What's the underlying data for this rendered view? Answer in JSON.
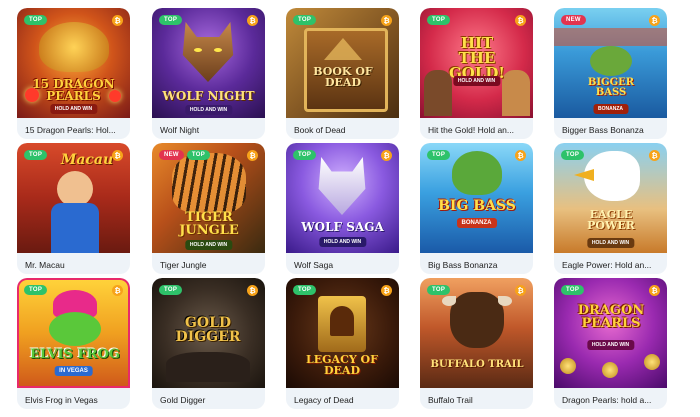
{
  "games": [
    {
      "title": "15 Dragon Pearls: Hol...",
      "badges": [
        "TOP"
      ],
      "bitcoin": true,
      "logo": "15 DRAGON PEARLS",
      "subtitle": "HOLD AND WIN"
    },
    {
      "title": "Wolf Night",
      "badges": [
        "TOP"
      ],
      "bitcoin": true,
      "logo": "WOLF NIGHT",
      "subtitle": "HOLD AND WIN"
    },
    {
      "title": "Book of Dead",
      "badges": [
        "TOP"
      ],
      "bitcoin": true,
      "logo": "BOOK OF DEAD",
      "subtitle": ""
    },
    {
      "title": "Hit the Gold! Hold an...",
      "badges": [
        "TOP"
      ],
      "bitcoin": true,
      "logo": "HIT THE GOLD!",
      "subtitle": "HOLD AND WIN"
    },
    {
      "title": "Bigger Bass Bonanza",
      "badges": [
        "NEW"
      ],
      "bitcoin": true,
      "logo": "BIGGER BASS",
      "subtitle": "BONANZA"
    },
    {
      "title": "Mr. Macau",
      "badges": [
        "TOP"
      ],
      "bitcoin": true,
      "logo": "Macau",
      "subtitle": ""
    },
    {
      "title": "Tiger Jungle",
      "badges": [
        "NEW",
        "TOP"
      ],
      "bitcoin": true,
      "logo": "TIGER JUNGLE",
      "subtitle": "HOLD AND WIN"
    },
    {
      "title": "Wolf Saga",
      "badges": [
        "TOP"
      ],
      "bitcoin": true,
      "logo": "WOLF SAGA",
      "subtitle": "HOLD AND WIN"
    },
    {
      "title": "Big Bass Bonanza",
      "badges": [
        "TOP"
      ],
      "bitcoin": true,
      "logo": "BIG BASS",
      "subtitle": "BONANZA"
    },
    {
      "title": "Eagle Power: Hold an...",
      "badges": [
        "TOP"
      ],
      "bitcoin": true,
      "logo": "EAGLE POWER",
      "subtitle": "HOLD AND WIN"
    },
    {
      "title": "Elvis Frog in Vegas",
      "badges": [
        "TOP"
      ],
      "bitcoin": true,
      "logo": "ELVIS FROG",
      "subtitle": "IN VEGAS"
    },
    {
      "title": "Gold Digger",
      "badges": [
        "TOP"
      ],
      "bitcoin": true,
      "logo": "GOLD DIGGER",
      "subtitle": ""
    },
    {
      "title": "Legacy of Dead",
      "badges": [
        "TOP"
      ],
      "bitcoin": true,
      "logo": "LEGACY OF DEAD",
      "subtitle": ""
    },
    {
      "title": "Buffalo Trail",
      "badges": [
        "TOP"
      ],
      "bitcoin": true,
      "logo": "BUFFALO TRAIL",
      "subtitle": ""
    },
    {
      "title": "Dragon Pearls: hold a...",
      "badges": [
        "TOP"
      ],
      "bitcoin": true,
      "logo": "DRAGON PEARLS",
      "subtitle": "HOLD AND WIN"
    }
  ],
  "icons": {
    "bitcoin": "bitcoin-icon",
    "bitcoin_glyph": "₿"
  },
  "colors": {
    "top_badge": "#2ec26a",
    "new_badge": "#e2344f",
    "bitcoin": "#f7a31a",
    "card_bg": "#eef3f8"
  }
}
